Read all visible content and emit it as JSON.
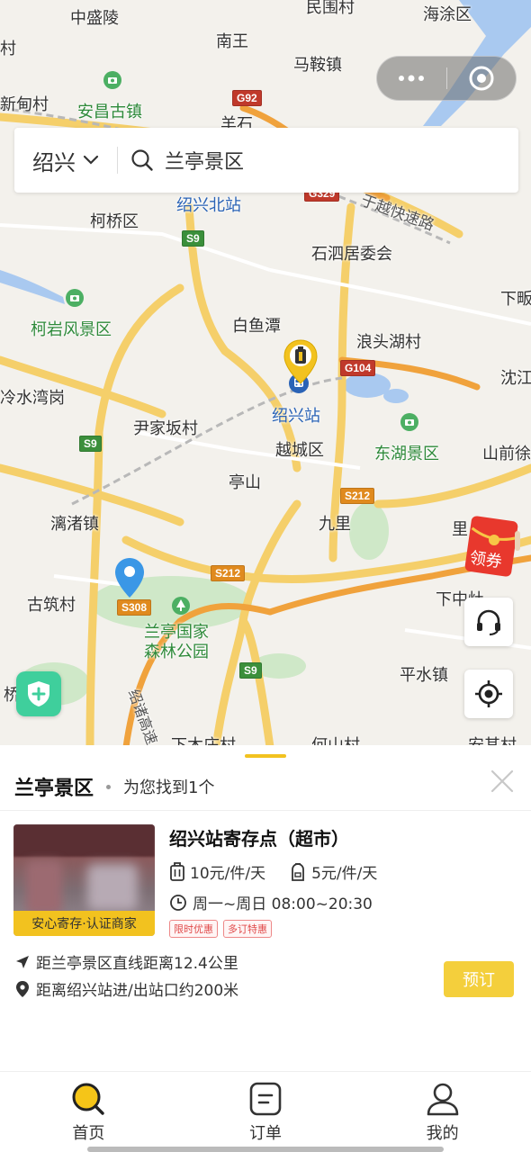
{
  "map": {
    "labels": {
      "zhongshengling": "中盛陵",
      "minwei": "民围村",
      "haitu": "海涂区",
      "cun": "村",
      "nanwang": "南王",
      "majian": "马鞍镇",
      "xindian": "新甸村",
      "anchang": "安昌古镇",
      "yangshi": "羊石",
      "shaoxingbei": "绍兴北站",
      "keqiao": "柯桥区",
      "yuyue": "于越快速路",
      "shisi": "石泗居委会",
      "xia_right": "下畈",
      "keyan": "柯岩风景区",
      "baiyutan": "白鱼潭",
      "langtou": "浪头湖村",
      "shenjiang": "沈江",
      "lengshui": "冷水湾岗",
      "shaoxingzhan": "绍兴站",
      "yinjiaban": "尹家坂村",
      "yuecheng": "越城区",
      "donghu": "东湖景区",
      "shanqian": "山前徐",
      "tingshan": "亭山",
      "jiuli": "九里",
      "lizhu": "漓渚镇",
      "li": "里",
      "guzhu": "古筑村",
      "xiazhong": "下中灶",
      "lanting_forest": "兰亭国家森林公园",
      "pingshui": "平水镇",
      "qiao": "桥",
      "shaozhu": "绍诸高速",
      "xiamu": "下木庄村",
      "heshan": "何山村",
      "anqi": "安其村"
    },
    "road_signs": {
      "g92": "G92",
      "g329": "G329",
      "s9a": "S9",
      "s9b": "S9",
      "s9c": "S9",
      "g104": "G104",
      "s212a": "S212",
      "s212b": "S212",
      "s308": "S308"
    },
    "coupon_label": "领券"
  },
  "search": {
    "city": "绍兴",
    "query": "兰亭景区"
  },
  "result": {
    "keyword": "兰亭景区",
    "count_text": "为您找到1个",
    "store": {
      "name": "绍兴站寄存点（超市）",
      "price_large": "10元/件/天",
      "price_small": "5元/件/天",
      "hours": "周一~周日 08:00~20:30",
      "badge": "安心寄存·认证商家",
      "tags": [
        "限时优惠",
        "多订特惠"
      ],
      "distance_line": "距兰亭景区直线距离12.4公里",
      "station_line": "距离绍兴站进/出站口约200米",
      "book_label": "预订"
    }
  },
  "tabs": [
    {
      "label": "首页",
      "icon": "search-home-icon",
      "active": true
    },
    {
      "label": "订单",
      "icon": "order-icon",
      "active": false
    },
    {
      "label": "我的",
      "icon": "profile-icon",
      "active": false
    }
  ],
  "colors": {
    "accent": "#f2c21f",
    "book_button": "#f4cf3c",
    "shield_button": "#3fcf9c",
    "tag_red": "#e04a4a",
    "map_blue": "#2a63b6"
  }
}
